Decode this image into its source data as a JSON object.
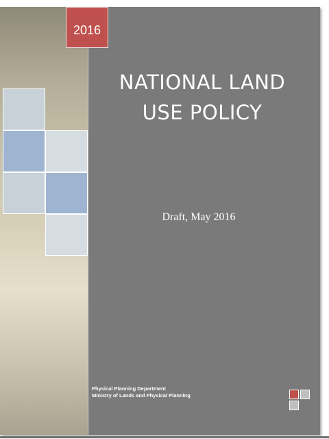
{
  "cover": {
    "year": "2016",
    "title_line1": "NATIONAL LAND",
    "title_line2": "USE POLICY",
    "subtitle": "Draft, May 2016",
    "org_line1": "Physical Planning Department",
    "org_line2": "Ministry of Lands and Physical Planning"
  },
  "colors": {
    "cover_background": "#7a7a7a",
    "year_badge": "#c0504d",
    "tile_blue": "#9fb4d1",
    "tile_light": "#c8d0d8",
    "logo_red": "#c0504d",
    "logo_gray": "#bfbfbf"
  }
}
